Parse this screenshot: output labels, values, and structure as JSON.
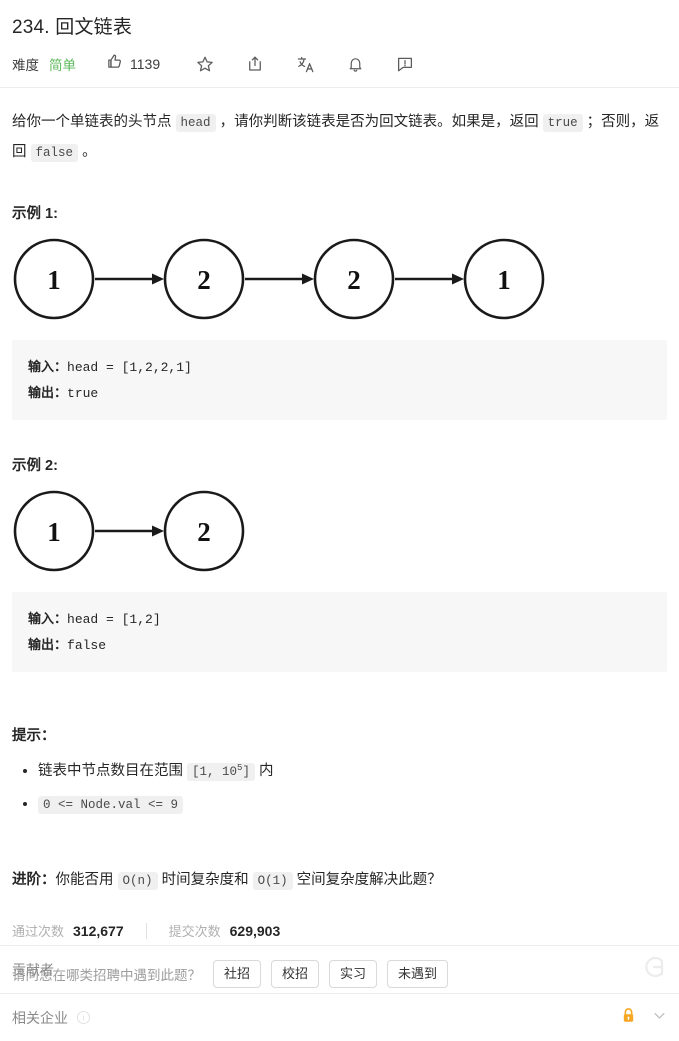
{
  "header": {
    "title": "234. 回文链表",
    "difficulty_label": "难度",
    "difficulty_value": "简单",
    "difficulty_color": "#5cb85c",
    "vote_count": "1139",
    "icons": [
      {
        "name": "thumbs-up-icon"
      },
      {
        "name": "star-icon"
      },
      {
        "name": "share-icon"
      },
      {
        "name": "translate-icon"
      },
      {
        "name": "bell-icon"
      },
      {
        "name": "feedback-icon"
      }
    ]
  },
  "description": {
    "part1": "给你一个单链表的头节点 ",
    "code1": "head",
    "part2": " ，请你判断该链表是否为回文链表。如果是，返回 ",
    "code2": "true",
    "part3": " ；否则，返回 ",
    "code3": "false",
    "part4": " 。"
  },
  "examples": [
    {
      "title": "示例 1:",
      "nodes": [
        "1",
        "2",
        "2",
        "1"
      ],
      "input_label": "输入：",
      "input_value": "head = [1,2,2,1]",
      "output_label": "输出：",
      "output_value": "true"
    },
    {
      "title": "示例 2:",
      "nodes": [
        "1",
        "2"
      ],
      "input_label": "输入：",
      "input_value": "head = [1,2]",
      "output_label": "输出：",
      "output_value": "false"
    }
  ],
  "hints": {
    "title": "提示：",
    "items": [
      {
        "prefix": "链表中节点数目在范围 ",
        "code_pre": "[1, 10",
        "code_sup": "5",
        "code_post": "]",
        "suffix": " 内"
      },
      {
        "code_only": "0 <= Node.val <= 9"
      }
    ]
  },
  "followup": {
    "label": "进阶：",
    "text1": "你能否用 ",
    "code1": "O(n)",
    "text2": " 时间复杂度和 ",
    "code2": "O(1)",
    "text3": " 空间复杂度解决此题？"
  },
  "stats": {
    "accepted_label": "通过次数",
    "accepted_value": "312,677",
    "submissions_label": "提交次数",
    "submissions_value": "629,903"
  },
  "survey": {
    "question": "请问您在哪类招聘中遇到此题？",
    "options": [
      "社招",
      "校招",
      "实习",
      "未遇到"
    ]
  },
  "footer": {
    "contributors_label": "贡献者",
    "companies_label": "相关企业",
    "lock_color": "#f5a623"
  }
}
